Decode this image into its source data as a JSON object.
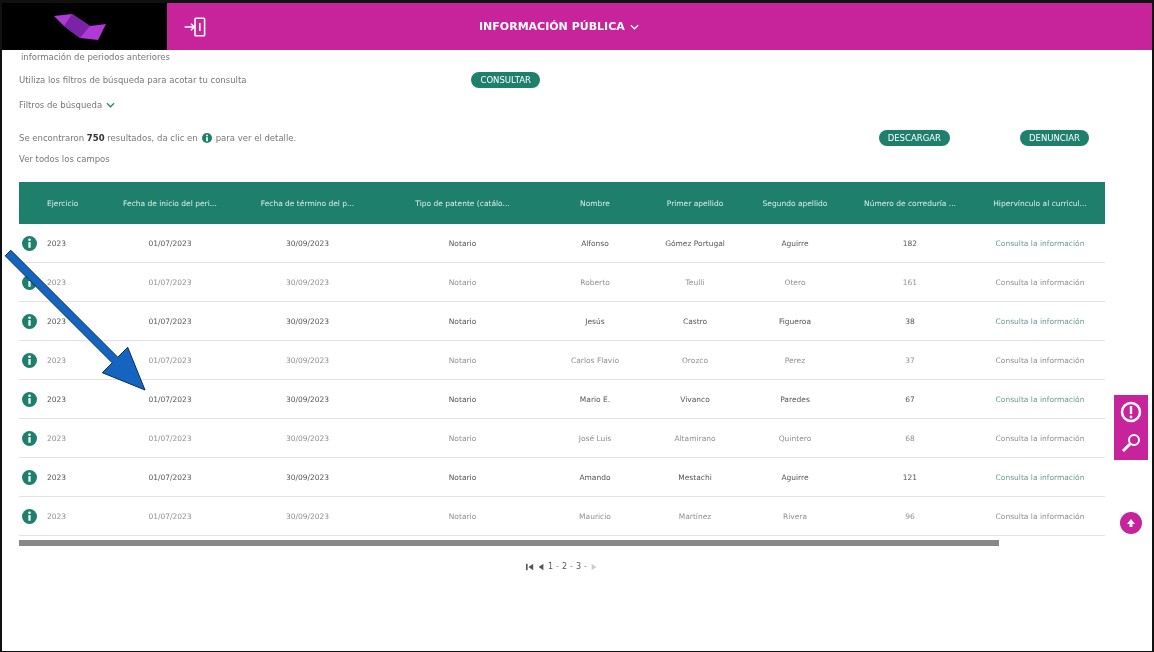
{
  "header": {
    "menu_label": "INFORMACIÓN PÚBLICA"
  },
  "intro": {
    "text": "información de periodos anteriores"
  },
  "filters": {
    "hint": "Utiliza los filtros de búsqueda para acotar tu consulta",
    "consult_button": "CONSULTAR",
    "toggle_label": "Filtros de búsqueda"
  },
  "results": {
    "text": "Se encontraron **750** resultados, da clic en",
    "text_after": "para ver el detalle.",
    "download_button": "DESCARGAR",
    "report_button": "DENUNCIAR",
    "all_fields_link": "Ver todos los campos"
  },
  "table": {
    "columns": [
      "Ejercicio",
      "Fecha de inicio del peri...",
      "Fecha de término del p...",
      "Tipo de patente (catálo...",
      "Nombre",
      "Primer apellido",
      "Segundo apellido",
      "Número de correduría ...",
      "Hipervínculo al curricul..."
    ],
    "rows": [
      {
        "faded": false,
        "cells": [
          "2023",
          "01/07/2023",
          "30/09/2023",
          "Notario",
          "Alfonso",
          "Gómez Portugal",
          "Aguirre",
          "182"
        ],
        "link": "Consulta la información"
      },
      {
        "faded": true,
        "cells": [
          "2023",
          "01/07/2023",
          "30/09/2023",
          "Notario",
          "Roberto",
          "Teulli",
          "Otero",
          "161"
        ],
        "link": "Consulta la información"
      },
      {
        "faded": false,
        "cells": [
          "2023",
          "01/07/2023",
          "30/09/2023",
          "Notario",
          "Jesús",
          "Castro",
          "Figueroa",
          "38"
        ],
        "link": "Consulta la información"
      },
      {
        "faded": true,
        "cells": [
          "2023",
          "01/07/2023",
          "30/09/2023",
          "Notario",
          "Carlos Flavio",
          "Orozco",
          "Perez",
          "37"
        ],
        "link": "Consulta la información"
      },
      {
        "faded": false,
        "cells": [
          "2023",
          "01/07/2023",
          "30/09/2023",
          "Notario",
          "Mario E.",
          "Vivanco",
          "Paredes",
          "67"
        ],
        "link": "Consulta la información"
      },
      {
        "faded": true,
        "cells": [
          "2023",
          "01/07/2023",
          "30/09/2023",
          "Notario",
          "José Luis",
          "Altamirano",
          "Quintero",
          "68"
        ],
        "link": "Consulta la información"
      },
      {
        "faded": false,
        "cells": [
          "2023",
          "01/07/2023",
          "30/09/2023",
          "Notario",
          "Amando",
          "Mestachi",
          "Aguirre",
          "121"
        ],
        "link": "Consulta la información"
      },
      {
        "faded": true,
        "cells": [
          "2023",
          "01/07/2023",
          "30/09/2023",
          "Notario",
          "Mauricio",
          "Martínez",
          "Rivera",
          "96"
        ],
        "link": "Consulta la información"
      }
    ]
  },
  "pagination": {
    "pages": [
      "1",
      "2",
      "3"
    ],
    "separator": "-"
  }
}
